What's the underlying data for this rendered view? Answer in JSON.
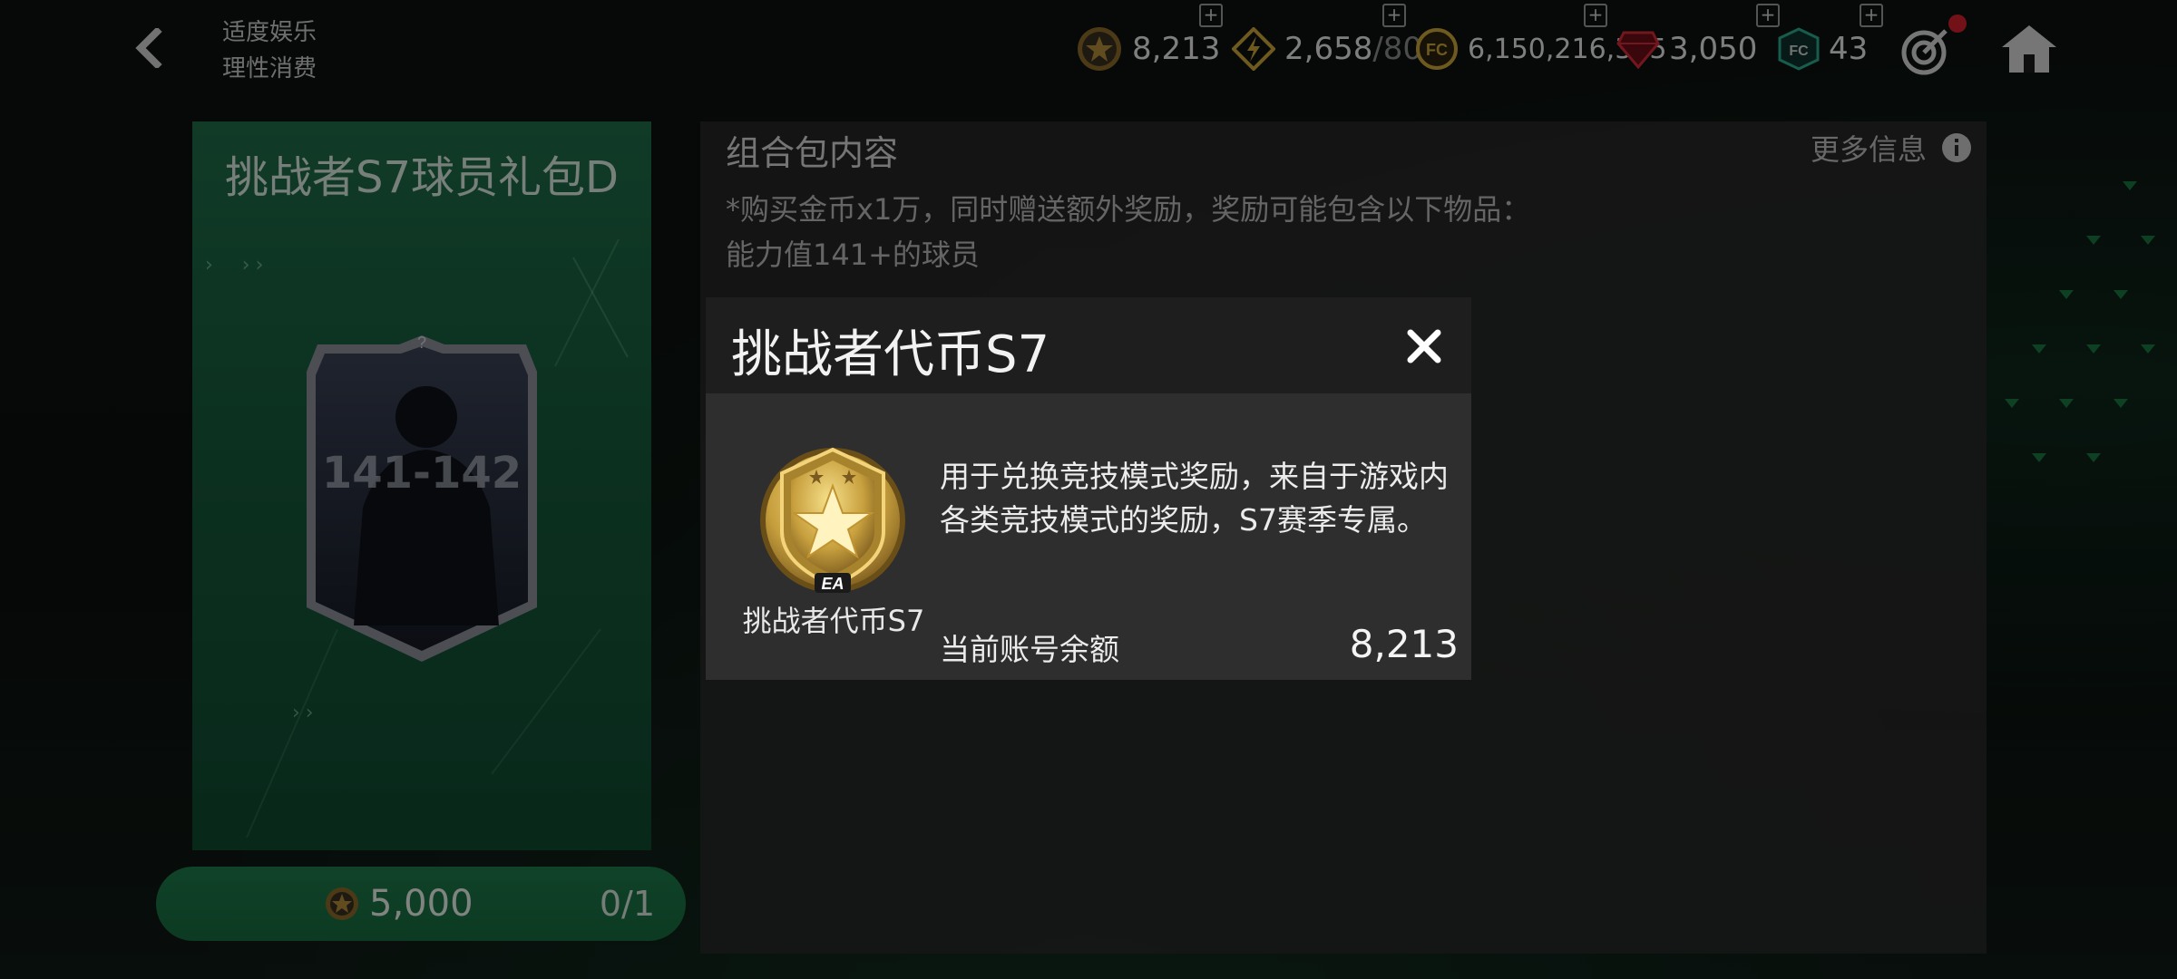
{
  "header": {
    "notice_line1": "适度娱乐",
    "notice_line2": "理性消费"
  },
  "currencies": [
    {
      "name": "challenger-token-icon",
      "value": "8,213"
    },
    {
      "name": "energy-icon",
      "value": "2,658",
      "suffix": "/80"
    },
    {
      "name": "coin-icon",
      "value": "6,150,216,355"
    },
    {
      "name": "gem-icon",
      "value": "3,050"
    },
    {
      "name": "fc-points-icon",
      "value": "43"
    }
  ],
  "pack": {
    "title": "挑战者S7球员礼包D",
    "rating": "141-142",
    "price": "5,000",
    "count": "0/1"
  },
  "contents": {
    "title": "组合包内容",
    "more_info": "更多信息",
    "desc_line1": "*购买金币x1万，同时赠送额外奖励，奖励可能包含以下物品：",
    "desc_line2": "能力值141+的球员"
  },
  "modal": {
    "title": "挑战者代币S7",
    "item_label": "挑战者代币S7",
    "description": "用于兑换竞技模式奖励，来自于游戏内各类竞技模式的奖励，S7赛季专属。",
    "balance_label": "当前账号余额",
    "balance_value": "8,213",
    "icon_text": "EA"
  },
  "colors": {
    "accent_green": "#1e7a4a",
    "modal_header": "#1e1e1e",
    "modal_body": "#2e2e2e",
    "gold": "#d4b04a"
  }
}
